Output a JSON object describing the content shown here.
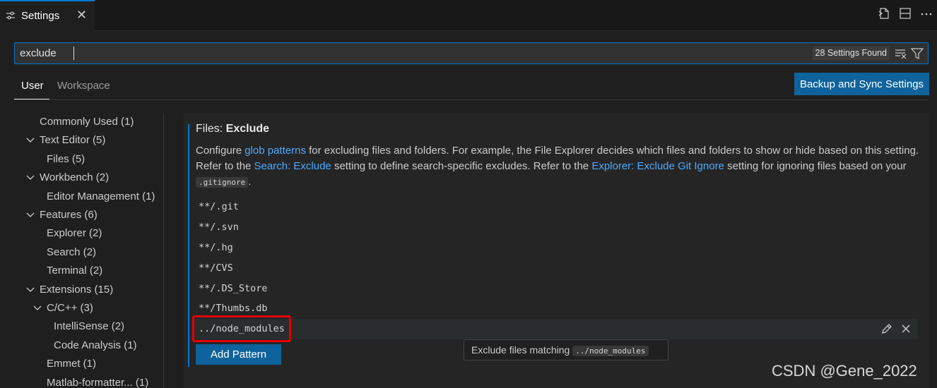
{
  "tab": {
    "title": "Settings",
    "close": "✕"
  },
  "search": {
    "value": "exclude",
    "results_badge": "28 Settings Found"
  },
  "scopes": {
    "user": "User",
    "workspace": "Workspace"
  },
  "sync_button": "Backup and Sync Settings",
  "toc": {
    "commonly_used": "Commonly Used (1)",
    "text_editor": "Text Editor (5)",
    "files": "Files (5)",
    "workbench": "Workbench (2)",
    "editor_management": "Editor Management (1)",
    "features": "Features (6)",
    "explorer": "Explorer (2)",
    "search": "Search (2)",
    "terminal": "Terminal (2)",
    "extensions": "Extensions (15)",
    "cpp": "C/C++ (3)",
    "intellisense": "IntelliSense (2)",
    "code_analysis": "Code Analysis (1)",
    "emmet": "Emmet (1)",
    "matlab": "Matlab-formatter... (1)"
  },
  "setting": {
    "category": "Files: ",
    "name": "Exclude",
    "desc_1": "Configure ",
    "link_glob": "glob patterns",
    "desc_2": " for excluding files and folders. For example, the File Explorer decides which files and folders to show or hide based on this setting. Refer to the ",
    "link_search_exclude": "Search: Exclude",
    "desc_3": " setting to define search-specific excludes. Refer to the ",
    "link_explorer_git": "Explorer: Exclude Git Ignore",
    "desc_4": " setting for ignoring files based on your ",
    "code_gitignore": ".gitignore",
    "desc_5": ".",
    "patterns": [
      "**/.git",
      "**/.svn",
      "**/.hg",
      "**/CVS",
      "**/.DS_Store",
      "**/Thumbs.db",
      "../node_modules"
    ],
    "add_button": "Add Pattern",
    "tooltip_text": "Exclude files matching ",
    "tooltip_code": "../node_modules"
  },
  "icons": {
    "tab": "settings-sliders-icon",
    "open_json": "open-settings-json-icon",
    "split": "split-editor-icon",
    "more": "more-actions-icon",
    "clear_filter": "clear-filter-icon",
    "filter": "filter-icon",
    "edit": "edit-pencil-icon",
    "remove": "remove-close-icon",
    "chevron": "chevron-down-icon"
  },
  "colors": {
    "accent": "#0078d4",
    "button": "#0e639c",
    "link": "#4daafc",
    "highlight": "#e00000"
  },
  "watermark": "CSDN @Gene_2022"
}
